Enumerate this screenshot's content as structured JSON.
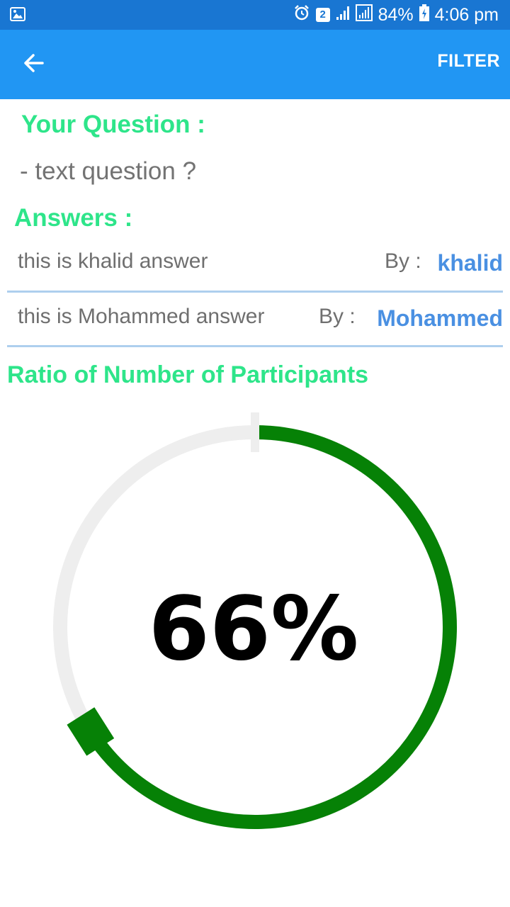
{
  "status_bar": {
    "icons": [
      "image-icon",
      "alarm-icon",
      "sim-badge-icon",
      "signal-icon",
      "signal-icon",
      "battery-charging-icon"
    ],
    "sim_badge": "2",
    "battery": "84%",
    "time": "4:06 pm"
  },
  "app_bar": {
    "back_icon": "arrow-left-icon",
    "filter_label": "FILTER"
  },
  "question": {
    "heading": "Your Question :",
    "text": "- text question  ?"
  },
  "answers": {
    "heading": "Answers :",
    "items": [
      {
        "text": "this is khalid answer",
        "by_label": "By :",
        "author": "khalid"
      },
      {
        "text": "this is Mohammed answer",
        "by_label": "By :",
        "author": "Mohammed"
      }
    ]
  },
  "ratio": {
    "heading": "Ratio of Number of Participants",
    "percent_label": "66%",
    "value": 66
  },
  "colors": {
    "status_bar": "#1976d2",
    "app_bar": "#2196f3",
    "heading_green": "#2ee58a",
    "author_blue": "#4a90e2",
    "progress_green": "#068106",
    "track_grey": "#eeeeee"
  }
}
